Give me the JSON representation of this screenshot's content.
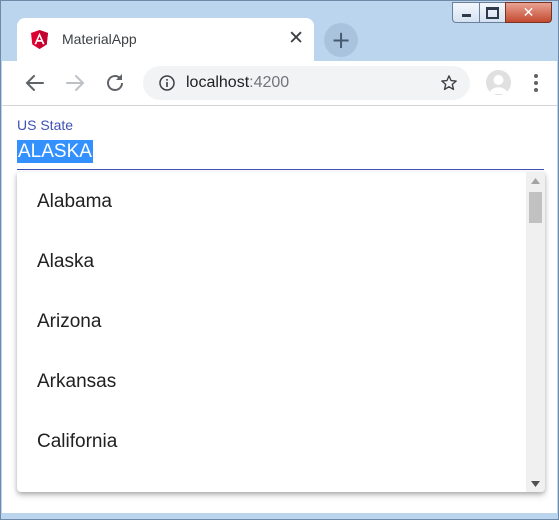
{
  "window": {
    "title_bar_icons": [
      "minimize-icon",
      "maximize-icon",
      "close-icon"
    ]
  },
  "tab": {
    "title": "MaterialApp",
    "favicon": "angular-icon",
    "close_glyph": "✕"
  },
  "newtab": {
    "glyph": "+"
  },
  "toolbar": {
    "url_host": "localhost",
    "url_port": ":4200",
    "icons": [
      "back-arrow-icon",
      "forward-arrow-icon",
      "reload-icon",
      "info-icon",
      "star-icon",
      "avatar-icon",
      "menu-icon"
    ]
  },
  "form": {
    "label": "US State",
    "value": "ALASKA"
  },
  "autocomplete": {
    "options": [
      "Alabama",
      "Alaska",
      "Arizona",
      "Arkansas",
      "California"
    ]
  },
  "colors": {
    "accent": "#3f51b5",
    "selection": "#3390ff",
    "angular_red": "#dd0031"
  }
}
